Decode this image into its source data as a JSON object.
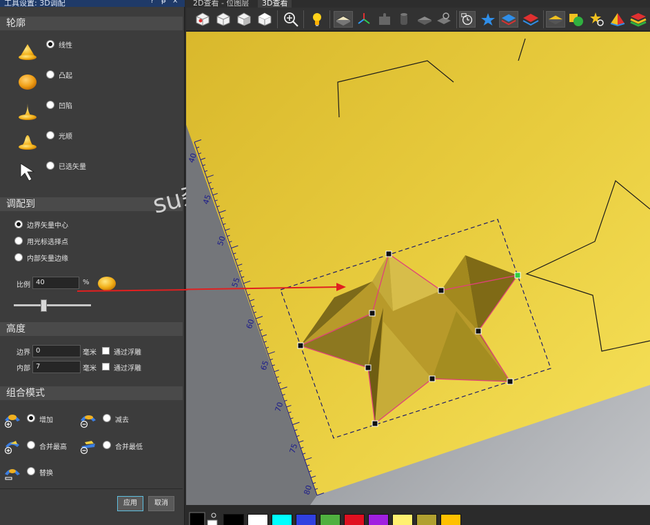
{
  "panel": {
    "title": "工具设置: 3D调配",
    "btn_help": "?",
    "btn_pin": "ᵽ",
    "btn_close": "×"
  },
  "outline": {
    "header": "轮廓",
    "options": [
      {
        "label": "线性",
        "selected": true,
        "icon": "linear-dome-icon"
      },
      {
        "label": "凸起",
        "selected": false,
        "icon": "convex-dome-icon"
      },
      {
        "label": "凹陷",
        "selected": false,
        "icon": "concave-dome-icon"
      },
      {
        "label": "光顺",
        "selected": false,
        "icon": "smooth-dome-icon"
      },
      {
        "label": "已选矢量",
        "selected": false,
        "icon": "selected-vector-icon"
      }
    ]
  },
  "fit": {
    "header": "调配到",
    "options": [
      {
        "label": "边界矢量中心",
        "selected": true
      },
      {
        "label": "用光标选择点",
        "selected": false
      },
      {
        "label": "内部矢量边缘",
        "selected": false
      }
    ],
    "ratio_label": "比例",
    "ratio_value": "40",
    "ratio_unit": "%",
    "slider_value": 0.4
  },
  "height": {
    "header": "高度",
    "rows": [
      {
        "label": "边界",
        "value": "0",
        "unit": "毫米",
        "check_label": "通过浮雕"
      },
      {
        "label": "内部",
        "value": "7",
        "unit": "毫米",
        "check_label": "通过浮雕"
      }
    ]
  },
  "combine": {
    "header": "组合模式",
    "options": [
      {
        "label": "增加",
        "selected": true,
        "icon": "add-mode-icon"
      },
      {
        "label": "减去",
        "selected": false,
        "icon": "subtract-mode-icon"
      },
      {
        "label": "合并最高",
        "selected": false,
        "icon": "merge-high-icon"
      },
      {
        "label": "合并最低",
        "selected": false,
        "icon": "merge-low-icon"
      },
      {
        "label": "替换",
        "selected": false,
        "icon": "replace-mode-icon"
      }
    ]
  },
  "actions": {
    "apply": "应用",
    "cancel": "取消"
  },
  "tabs": [
    {
      "label": "2D查看 - 位图层",
      "active": false
    },
    {
      "label": "3D查看",
      "active": true
    }
  ],
  "toolbar_icons": [
    "view-iso-icon",
    "view-front-icon",
    "view-side-icon",
    "view-top-icon",
    "zoom-icon",
    "light-bulb-icon",
    "relief-surface-icon",
    "axes-icon",
    "puzzle-icon",
    "cylinder-icon",
    "gray-block-icon",
    "block-settings-icon",
    "clock-view-icon",
    "blue-star-icon",
    "blue-layer-icon",
    "red-layer-icon",
    "yellow-layer-icon",
    "shapes-icon",
    "star-search-icon",
    "pyramid-icon",
    "color-layers-icon"
  ],
  "ruler_labels": [
    "40",
    "45",
    "50",
    "55",
    "60",
    "65",
    "70",
    "75",
    "80"
  ],
  "watermark": "su杂玩",
  "palette": {
    "colors": [
      "#000000",
      "#ffffff",
      "#00ffff",
      "#3040e0",
      "#50b040",
      "#e01020",
      "#a020e0",
      "#fff070",
      "#b0a030",
      "#ffc000"
    ]
  }
}
